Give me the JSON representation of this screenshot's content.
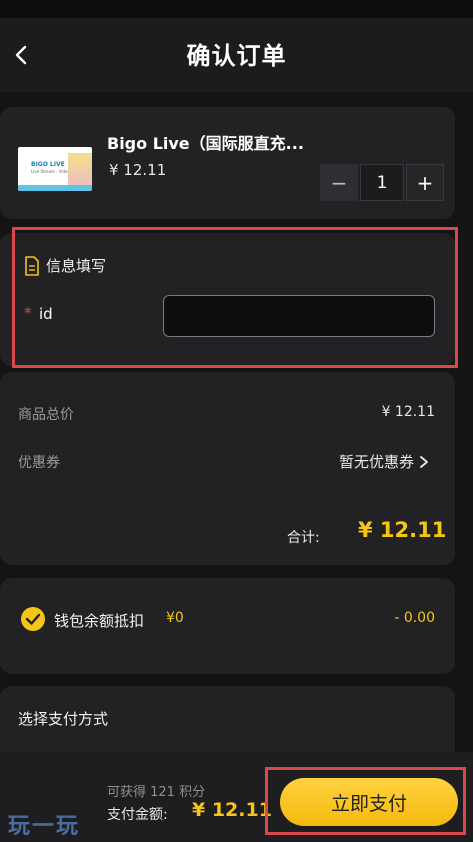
{
  "header": {
    "title": "确认订单"
  },
  "product": {
    "name": "Bigo Live（国际服直充...",
    "price": "¥ 12.11",
    "quantity": "1",
    "thumb_logo": "BIGO LIVE",
    "thumb_sub": "Live Stream · Video Chat"
  },
  "stepper": {
    "minus": "−",
    "plus": "+"
  },
  "info": {
    "title": "信息填写",
    "required_mark": "*",
    "id_label": "id",
    "id_value": ""
  },
  "summary": {
    "goods_total_label": "商品总价",
    "goods_total_value": "¥ 12.11",
    "coupon_label": "优惠券",
    "coupon_value": "暂无优惠券",
    "total_label": "合计:",
    "total_value": "¥ 12.11"
  },
  "wallet": {
    "label": "钱包余额抵扣",
    "balance": "¥0",
    "deduction": "- 0.00"
  },
  "payment": {
    "title": "选择支付方式"
  },
  "bottom": {
    "points": "可获得 121 积分",
    "amount_label": "支付金额:",
    "amount_value": "¥ 12.11",
    "pay_button": "立即支付"
  },
  "watermark": "玩一玩",
  "colors": {
    "accent": "#f5c518",
    "highlight": "#d9474f",
    "background": "#141414"
  }
}
